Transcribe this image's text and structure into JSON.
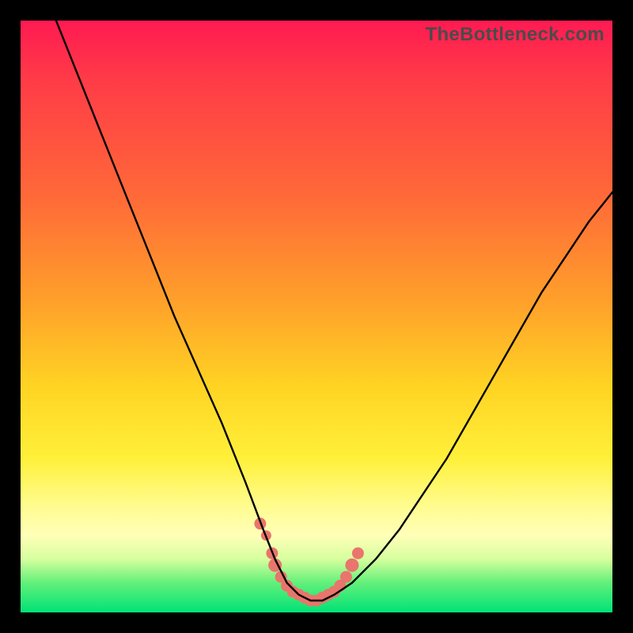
{
  "watermark": "TheBottleneck.com",
  "colors": {
    "page_bg": "#000000",
    "gradient_stops": [
      "#ff1a52",
      "#ff3b47",
      "#ff6a38",
      "#ffa22a",
      "#ffd423",
      "#fff03a",
      "#fffc8f",
      "#ffffb8",
      "#d6ff9e",
      "#62f07a",
      "#00e276"
    ],
    "curve": "#000000",
    "marker": "#e9756c",
    "watermark": "#4b4b4b"
  },
  "chart_data": {
    "type": "line",
    "title": "",
    "xlabel": "",
    "ylabel": "",
    "xlim": [
      0,
      100
    ],
    "ylim": [
      0,
      100
    ],
    "series": [
      {
        "name": "bottleneck-curve",
        "x": [
          6,
          10,
          14,
          18,
          22,
          26,
          30,
          34,
          38,
          41,
          43,
          45,
          47,
          49,
          51,
          53,
          56,
          60,
          64,
          68,
          72,
          76,
          80,
          84,
          88,
          92,
          96,
          100
        ],
        "y": [
          100,
          90,
          80,
          70,
          60,
          50,
          41,
          32,
          22,
          14,
          9,
          5,
          3,
          2,
          2,
          3,
          5,
          9,
          14,
          20,
          26,
          33,
          40,
          47,
          54,
          60,
          66,
          71
        ]
      }
    ],
    "markers": {
      "name": "highlighted-range",
      "x": [
        40.5,
        41.5,
        42.5,
        43,
        44,
        45,
        46,
        47,
        48,
        49,
        50,
        51,
        52,
        53,
        54,
        55,
        56,
        57
      ],
      "y": [
        15,
        13,
        10,
        8,
        6,
        4.5,
        3.5,
        3,
        2.5,
        2,
        2,
        2.5,
        3,
        3.5,
        4.5,
        6,
        8,
        10
      ],
      "r": [
        7,
        6,
        7,
        8,
        7,
        7,
        7,
        7,
        7,
        7,
        7,
        7,
        7,
        7,
        7,
        7,
        8,
        7
      ]
    }
  }
}
